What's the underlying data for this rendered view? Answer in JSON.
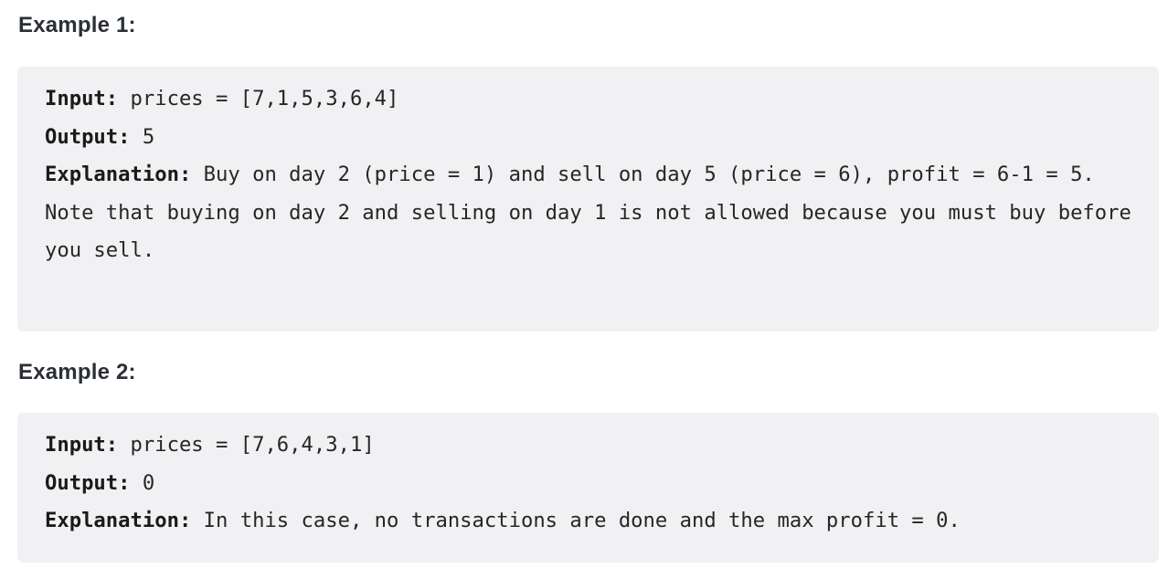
{
  "examples": [
    {
      "heading": "Example 1:",
      "input_label": "Input:",
      "input_value": " prices = [7,1,5,3,6,4]",
      "output_label": "Output:",
      "output_value": " 5",
      "explanation_label": "Explanation:",
      "explanation_value": " Buy on day 2 (price = 1) and sell on day 5 (price = 6), profit = 6-1 = 5.",
      "note": "Note that buying on day 2 and selling on day 1 is not allowed because you must buy before you sell."
    },
    {
      "heading": "Example 2:",
      "input_label": "Input:",
      "input_value": " prices = [7,6,4,3,1]",
      "output_label": "Output:",
      "output_value": " 0",
      "explanation_label": "Explanation:",
      "explanation_value": " In this case, no transactions are done and the max profit = 0."
    }
  ]
}
